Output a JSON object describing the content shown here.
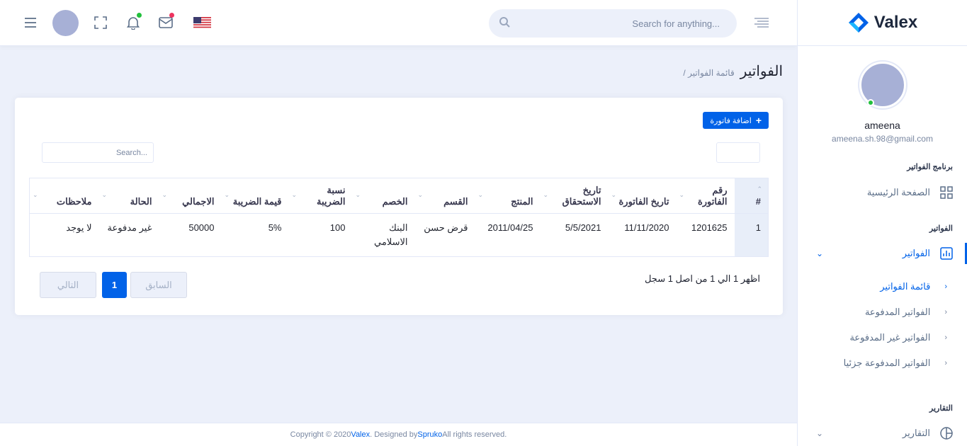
{
  "brand": {
    "name": "Valex"
  },
  "header": {
    "search_placeholder": "Search for anything...",
    "flag": "us-flag-icon"
  },
  "profile": {
    "name": "ameena",
    "email": "ameena.sh.98@gmail.com"
  },
  "sidebar": {
    "cat_program": "برنامج الفواتير",
    "home": "الصفحة الرئيسية",
    "cat_invoices": "الفواتير",
    "invoices": "الفواتير",
    "sub": [
      "قائمة الفواتير",
      "الفواتير المدفوعة",
      "الفواتير غير المدفوعة",
      "الفواتير المدفوعة جزئيا"
    ],
    "cat_reports": "التقارير",
    "reports": "التقارير"
  },
  "page": {
    "title": "الفواتير",
    "breadcrumb": "/ قائمة الفواتير"
  },
  "card": {
    "add_button": "اضافة فاتورة",
    "search_placeholder": "Search...",
    "columns": [
      "#",
      "رقم الفاتورة",
      "تاريخ الفاتورة",
      "تاريخ الاستحقاق",
      "المنتج",
      "القسم",
      "الخصم",
      "نسبة الضريبة",
      "قيمة الضريبة",
      "الاجمالي",
      "الحالة",
      "ملاحظات"
    ],
    "rows": [
      [
        "1",
        "1201625",
        "11/11/2020",
        "5/5/2021",
        "2011/04/25",
        "قرض حسن",
        "البنك الاسلامي",
        "100",
        "5%",
        "50000",
        "غير مدفوعة",
        "لا يوجد"
      ]
    ],
    "info": "اظهر 1 الي 1 من اصل 1 سجل",
    "prev": "السابق",
    "page": "1",
    "next": "التالي"
  },
  "footer": {
    "prefix": "Copyright © 2020 ",
    "brand": "Valex",
    "mid": ". Designed by ",
    "designer": "Spruko",
    "suffix": " All rights reserved."
  },
  "colors": {
    "primary": "#0162e8",
    "bg": "#ecf0fa",
    "online": "#22c03c",
    "mail_dot": "#ee335e"
  }
}
